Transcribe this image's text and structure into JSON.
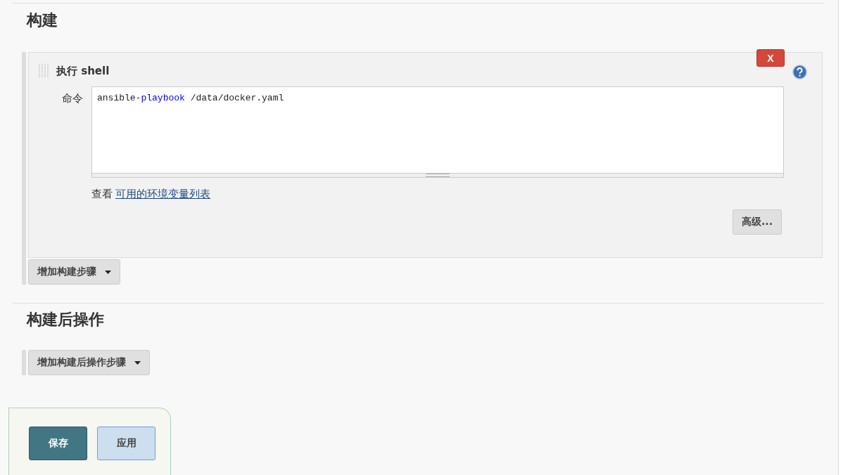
{
  "build_section": {
    "heading": "构建",
    "step": {
      "title": "执行 shell",
      "delete_label": "X",
      "field_label": "命令",
      "command": [
        {
          "kind": "plain",
          "text": "ansible-"
        },
        {
          "kind": "keyword",
          "text": "playbook"
        },
        {
          "kind": "plain",
          "text": " /data/docker.yaml"
        }
      ],
      "env_prefix": "查看",
      "env_link": "可用的环境变量列表",
      "advanced_button": "高级..."
    },
    "add_button": "增加构建步骤"
  },
  "post_build_section": {
    "heading": "构建后操作",
    "add_button": "增加构建后操作步骤"
  },
  "footer": {
    "buttons": [
      {
        "label": "保存",
        "kind": "primary"
      },
      {
        "label": "应用",
        "kind": "secondary"
      }
    ]
  }
}
